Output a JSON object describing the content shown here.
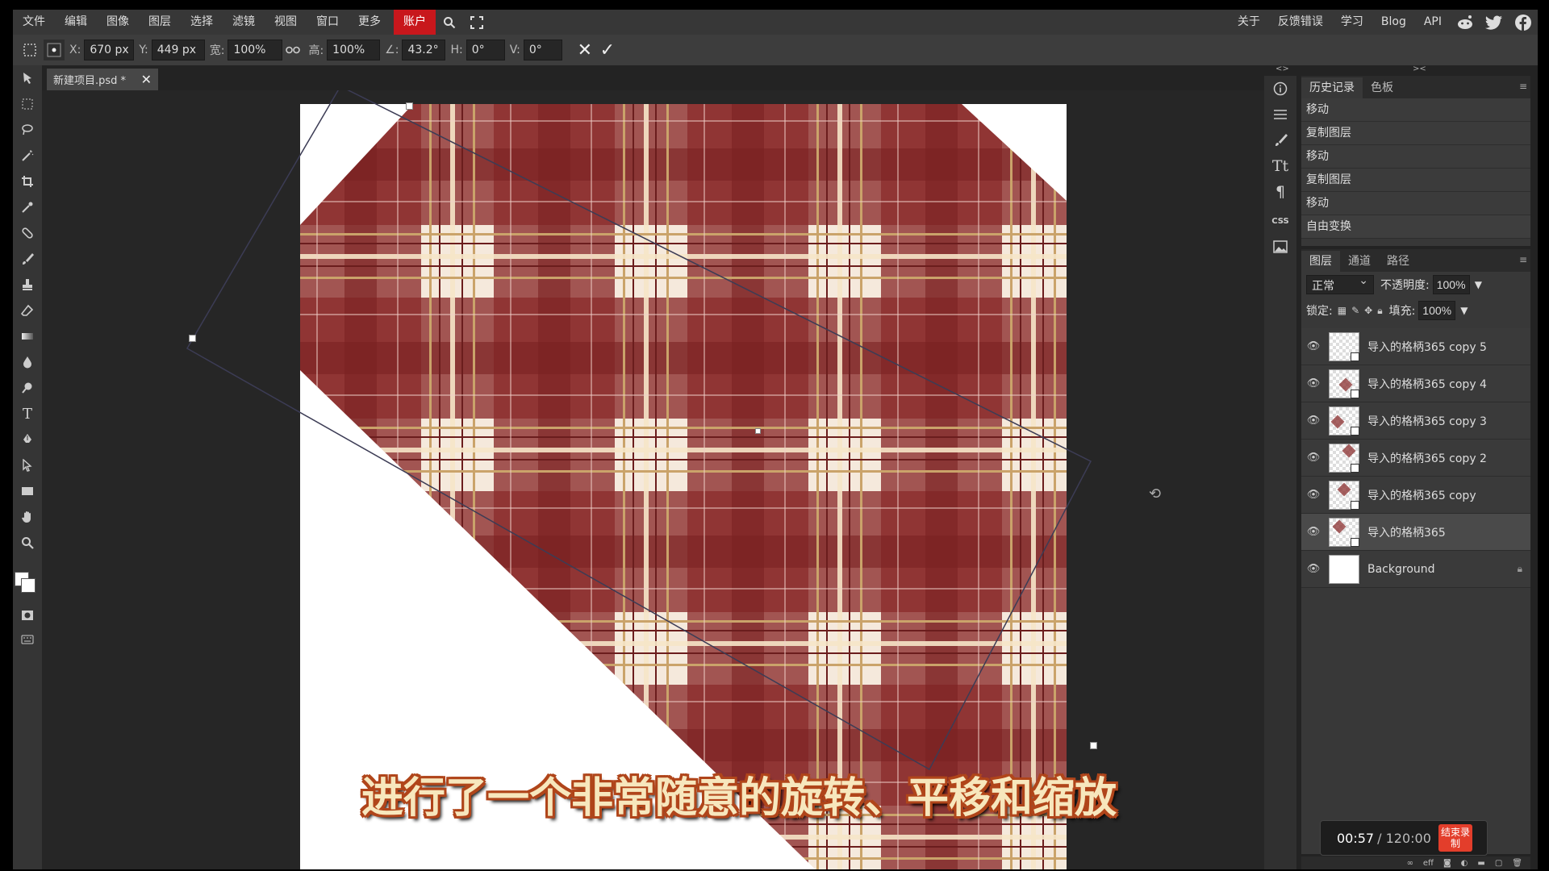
{
  "menu": {
    "items": [
      "文件",
      "编辑",
      "图像",
      "图层",
      "选择",
      "滤镜",
      "视图",
      "窗口",
      "更多"
    ],
    "account": "账户",
    "right_items": [
      "关于",
      "反馈错误",
      "学习",
      "Blog",
      "API"
    ]
  },
  "options": {
    "x_label": "X:",
    "x_value": "670 px",
    "y_label": "Y:",
    "y_value": "449 px",
    "w_label": "宽:",
    "w_value": "100%",
    "h_label": "高:",
    "h_value": "100%",
    "angle_label": "∠:",
    "angle_value": "43.2°",
    "skew_h_label": "H:",
    "skew_h_value": "0°",
    "skew_v_label": "V:",
    "skew_v_value": "0°"
  },
  "document": {
    "tab_title": "新建项目.psd *"
  },
  "history": {
    "tabs": [
      "历史记录",
      "色板"
    ],
    "items": [
      "移动",
      "复制图层",
      "移动",
      "复制图层",
      "移动",
      "自由变换"
    ]
  },
  "layers": {
    "tabs": [
      "图层",
      "通道",
      "路径"
    ],
    "blend_mode": "正常",
    "opacity_label": "不透明度:",
    "opacity_value": "100%",
    "lock_label": "锁定:",
    "fill_label": "填充:",
    "fill_value": "100%",
    "items": [
      {
        "name": "导入的格柄365 copy 5"
      },
      {
        "name": "导入的格柄365 copy 4"
      },
      {
        "name": "导入的格柄365 copy 3"
      },
      {
        "name": "导入的格柄365 copy 2"
      },
      {
        "name": "导入的格柄365 copy"
      },
      {
        "name": "导入的格柄365"
      },
      {
        "name": "Background"
      }
    ]
  },
  "subtitle": "进行了一个非常随意的旋转、平移和缩放",
  "recorder": {
    "elapsed": "00:57",
    "total": "/ 120:00",
    "stop_label": "结束录制"
  },
  "colors": {
    "accent": "#c8171c",
    "plaid": "#8b2c2c",
    "subtitle_fill": "#f7e7bd",
    "subtitle_stroke": "#b0451a"
  }
}
